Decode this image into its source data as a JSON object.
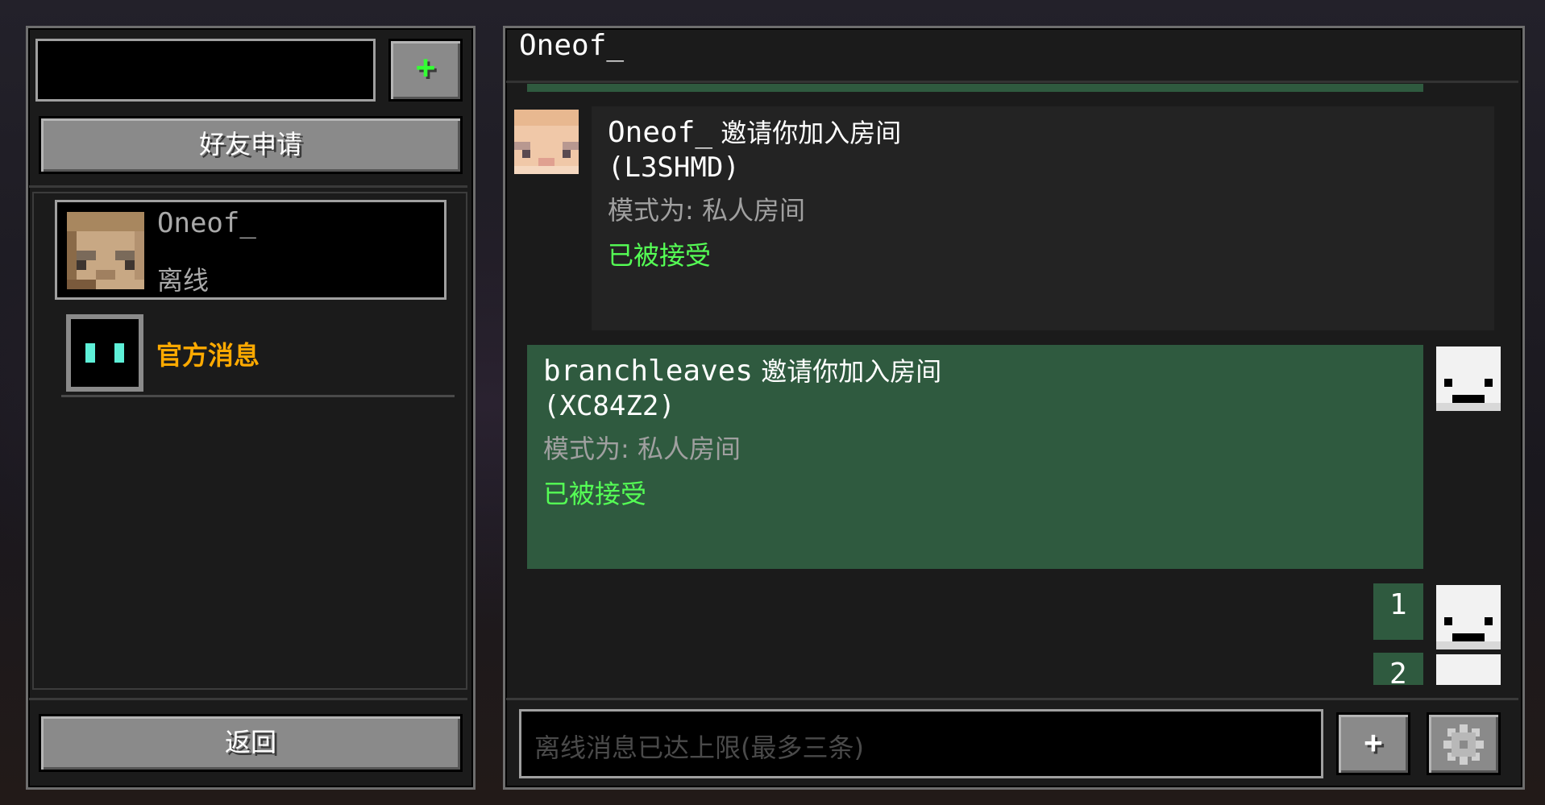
{
  "sidebar": {
    "search_value": "",
    "add_friend_label": "+",
    "friend_requests_label": "好友申请",
    "contacts": [
      {
        "name": "Oneof_",
        "status": "离线"
      },
      {
        "name": "官方消息"
      }
    ],
    "back_label": "返回"
  },
  "chat": {
    "title": "Oneof_",
    "messages": [
      {
        "sender": "Oneof_",
        "action": " 邀请你加入房间",
        "room_code": "(L3SHMD)",
        "mode": "模式为: 私人房间",
        "status": "已被接受"
      },
      {
        "sender": "branchleaves",
        "action": " 邀请你加入房间",
        "room_code": "(XC84Z2)",
        "mode": "模式为: 私人房间",
        "status": "已被接受"
      },
      {
        "text": "1"
      },
      {
        "text": "2"
      }
    ],
    "input_placeholder": "离线消息已达上限(最多三条)",
    "attach_label": "+",
    "settings_icon": "gear-icon"
  },
  "colors": {
    "accent_green": "#2f5a3f",
    "accepted_green": "#55ff55",
    "official_gold": "#ffaa00",
    "muted_gray": "#a0a0a0"
  }
}
